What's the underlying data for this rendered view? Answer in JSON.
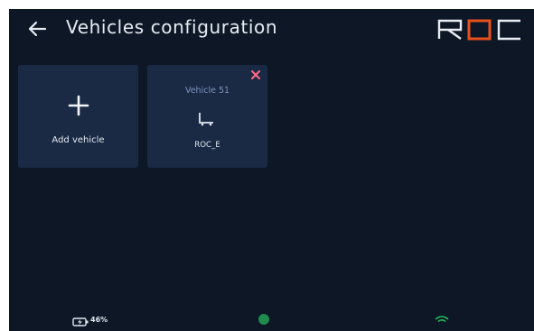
{
  "header": {
    "title": "Vehicles configuration",
    "back_icon": "arrow-left-icon",
    "logo_text": "ROC",
    "logo_accent_color": "#e8501e"
  },
  "cards": {
    "add": {
      "label": "Add vehicle",
      "icon": "plus-icon"
    },
    "vehicle": {
      "name": "Vehicle 51",
      "type": "ROC_E",
      "remove_icon": "close-icon",
      "remove_color": "#ff6b81",
      "type_icon": "cart-icon"
    }
  },
  "status_bar": {
    "battery_percent": "46%",
    "battery_icon": "battery-charging-icon",
    "status_icon": "status-dot-icon",
    "status_color": "#1f8b4c",
    "wifi_icon": "wifi-icon",
    "wifi_color": "#22c55e"
  }
}
